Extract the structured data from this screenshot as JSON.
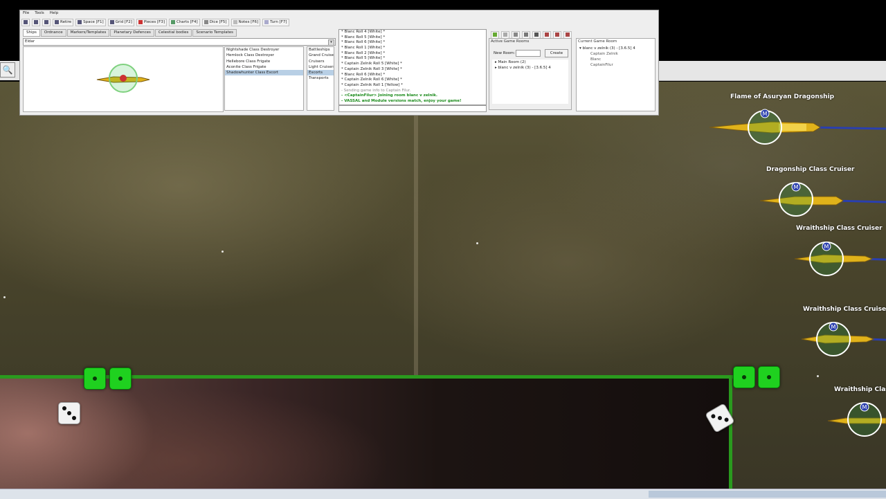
{
  "menu": [
    "File",
    "Tools",
    "Help"
  ],
  "toolbar": [
    {
      "label": "Retire"
    },
    {
      "label": "Space [F1]"
    },
    {
      "label": "Grid [F2]"
    },
    {
      "label": "Pieces [F3]"
    },
    {
      "label": "Charts [F4]"
    },
    {
      "label": "Dice [F5]"
    },
    {
      "label": "Notes [F6]"
    },
    {
      "label": "Turn [F7]"
    }
  ],
  "tabs": [
    "Ships",
    "Ordnance",
    "Markers/Templates",
    "Planetary Defences",
    "Celestial bodies",
    "Scenario Templates"
  ],
  "combo_value": "Eldar",
  "ship_list": [
    "Nightshade Class Destroyer",
    "Hemlock Class Destroyer",
    "Hellebore Class Frigate",
    "Aconite Class Frigate",
    "Shadowhunter Class Escort"
  ],
  "ship_list_selected": 4,
  "category_list": [
    "Battleships",
    "Grand Cruiser",
    "Cruisers",
    "Light Cruisers",
    "Escorts",
    "Transports"
  ],
  "category_selected": 4,
  "chat": [
    {
      "t": "* Blanc Roll 4 [White] *",
      "s": "n"
    },
    {
      "t": "* Blanc Roll 5 [White] *",
      "s": "n"
    },
    {
      "t": "* Blanc Roll 6 [White] *",
      "s": "n"
    },
    {
      "t": "* Blanc Roll 1 [White] *",
      "s": "n"
    },
    {
      "t": "* Blanc Roll 2 [White] *",
      "s": "n"
    },
    {
      "t": "* Blanc Roll 5 [White] *",
      "s": "n"
    },
    {
      "t": "* Captain Zelnik Roll 5 [White] *",
      "s": "n"
    },
    {
      "t": "* Captain Zelnik Roll 3 [White] *",
      "s": "n"
    },
    {
      "t": "* Blanc Roll 6 [White] *",
      "s": "n"
    },
    {
      "t": "* Captain Zelnik Roll 6 [White] *",
      "s": "n"
    },
    {
      "t": "* Captain Zelnik Roll 1 [Yellow] *",
      "s": "n"
    },
    {
      "t": "- Sending game info to Captain Filur.",
      "s": "gy"
    },
    {
      "t": "- <CaptainFilur> Joining room blanc v zelnik.",
      "s": "g"
    },
    {
      "t": "- VASSAL and Module versions match, enjoy your game!",
      "s": "g"
    }
  ],
  "rooms": {
    "title": "Active Game Rooms",
    "new_room_label": "New Room:",
    "create_label": "Create",
    "items": [
      "Main Room (2)",
      "blanc v zelnik (3) - [3.6.5] 4"
    ]
  },
  "current_room": {
    "title": "Current Game Room",
    "room": "blanc v zelnik (3) - [3.6.5] 4",
    "players": [
      "Captain Zelnik",
      "Blanc",
      "CaptainFilur"
    ]
  },
  "ships": [
    {
      "label": "Flame of Asuryan Dragonship"
    },
    {
      "label": "Dragonship Class Cruiser"
    },
    {
      "label": "Wraithship Class Cruiser"
    },
    {
      "label": "Wraithship Class Cruiser"
    },
    {
      "label": "Wraithship Class Cr"
    }
  ],
  "marker_letter": "M",
  "colors": {
    "accent_green": "#1fd11f",
    "board_border": "#2a9a1e",
    "ship_gold": "#e0b21a",
    "ship_blue": "#2a3fae"
  }
}
